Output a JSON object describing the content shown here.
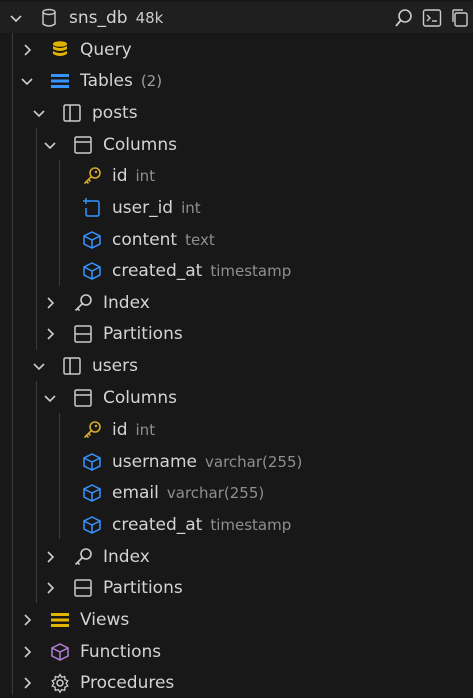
{
  "connection": {
    "name": "sns_db",
    "size": "48k"
  },
  "nodes": {
    "query": "Query",
    "tables": "Tables",
    "tables_count": "(2)",
    "views": "Views",
    "functions": "Functions",
    "procedures": "Procedures"
  },
  "tables": [
    {
      "name": "posts",
      "columns_label": "Columns",
      "columns": [
        {
          "name": "id",
          "type": "int",
          "icon": "key-icon"
        },
        {
          "name": "user_id",
          "type": "int",
          "icon": "foreign-key-icon"
        },
        {
          "name": "content",
          "type": "text",
          "icon": "cube-icon"
        },
        {
          "name": "created_at",
          "type": "timestamp",
          "icon": "cube-icon"
        }
      ],
      "index_label": "Index",
      "partitions_label": "Partitions"
    },
    {
      "name": "users",
      "columns_label": "Columns",
      "columns": [
        {
          "name": "id",
          "type": "int",
          "icon": "key-icon"
        },
        {
          "name": "username",
          "type": "varchar(255)",
          "icon": "cube-icon"
        },
        {
          "name": "email",
          "type": "varchar(255)",
          "icon": "cube-icon"
        },
        {
          "name": "created_at",
          "type": "timestamp",
          "icon": "cube-icon"
        }
      ],
      "index_label": "Index",
      "partitions_label": "Partitions"
    }
  ],
  "colors": {
    "background": "#181818",
    "text": "#d4d4d4",
    "muted": "#8f8f8f",
    "yellow": "#e2b400",
    "blue": "#3794ff",
    "purple": "#b180d7",
    "key": "#d7a72a"
  }
}
